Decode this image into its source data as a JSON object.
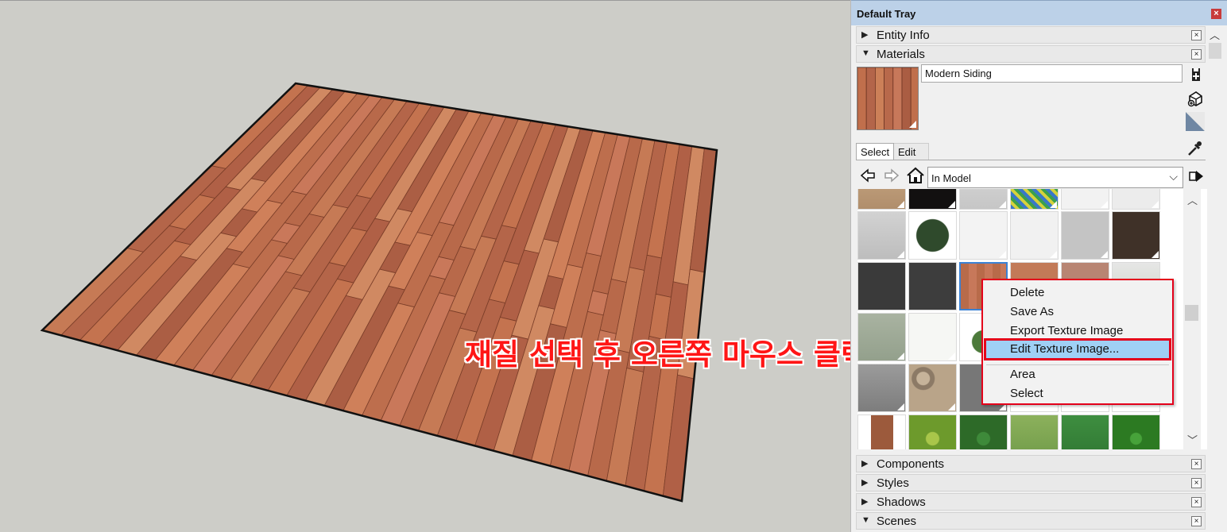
{
  "annotation": {
    "text": "재질 선택 후 오른쪽 마우스 클릭"
  },
  "tray": {
    "title": "Default Tray",
    "close_label": "×",
    "panels": {
      "entity_info": {
        "label": "Entity Info",
        "expanded": false
      },
      "materials": {
        "label": "Materials",
        "expanded": true
      },
      "components": {
        "label": "Components",
        "expanded": false
      },
      "styles": {
        "label": "Styles",
        "expanded": false
      },
      "shadows": {
        "label": "Shadows",
        "expanded": false
      },
      "scenes": {
        "label": "Scenes",
        "expanded": true
      }
    },
    "panel_close_label": "×"
  },
  "materials": {
    "name": "Modern Siding",
    "tabs": {
      "select": "Select",
      "edit": "Edit"
    },
    "collection": "In Model",
    "chevron": "⌵"
  },
  "context_menu": {
    "items": {
      "delete": "Delete",
      "save_as": "Save As",
      "export": "Export Texture Image",
      "edit": "Edit Texture Image...",
      "area": "Area",
      "select": "Select"
    },
    "highlighted": "Edit Texture Image..."
  },
  "colors": {
    "highlight": "#9fd0f5",
    "annotation": "#ff1616",
    "accent_border": "#e4001a",
    "selection": "#3b82d4"
  },
  "icons": [
    "create-material-icon",
    "paint-bucket-icon",
    "display-secondary-icon",
    "eyedropper-icon",
    "back-icon",
    "forward-icon",
    "home-icon",
    "details-icon",
    "dropdown-icon",
    "arrow-right-icon"
  ]
}
